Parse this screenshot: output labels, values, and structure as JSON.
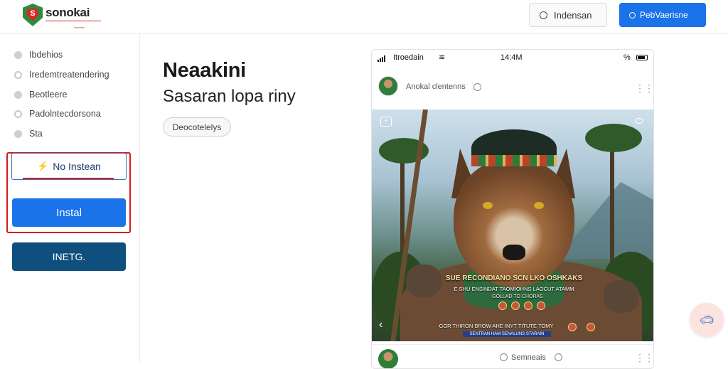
{
  "header": {
    "logo_text": "sonokai",
    "logo_tagline": "Homefix",
    "logo_mark_letter": "S",
    "search_label": "Indensan",
    "primary_label": "PebVaerisne"
  },
  "sidebar": {
    "items": [
      {
        "label": "Ibdehios",
        "icon": "bullet-dot"
      },
      {
        "label": "Iredemtreatendering",
        "icon": "radio-ring"
      },
      {
        "label": "Beotleere",
        "icon": "bullet-dot"
      },
      {
        "label": "Padolntecdorsona",
        "icon": "radio-ring"
      },
      {
        "label": "Sta",
        "icon": "bullet-dot"
      }
    ],
    "outline_button": "No Instean",
    "install_button": "Instal",
    "dark_button": "INETG."
  },
  "main": {
    "title": "Neaakini",
    "subtitle": "Sasaran lopa riny",
    "chip": "Deocotelelys"
  },
  "phone": {
    "status": {
      "carrier": "Itroedain",
      "time": "14:4M",
      "battery": "%"
    },
    "post": {
      "account": "Anokal clentenns",
      "overlay_title": "SUE RECONDIANO SCN LKO OSHKAKS",
      "overlay_sub": "E SHU ENSINDAT TAOMIOHNS LAOCUT ATAMM",
      "overlay_small": "GOLLAD TO CHORAS",
      "bottom_text": "GOR THIRON BROW AHE INYT TITUTE TOMY",
      "bottom_chip": "SENTRAN HAM SENALUNS STARAIN",
      "footer_text": "Semneais"
    }
  },
  "colors": {
    "primary": "#1a73e8",
    "dark": "#0f4f7d",
    "highlight": "#d71a1a",
    "fab_bg": "#fbe3df"
  },
  "fab": {
    "icon": "car-icon"
  }
}
